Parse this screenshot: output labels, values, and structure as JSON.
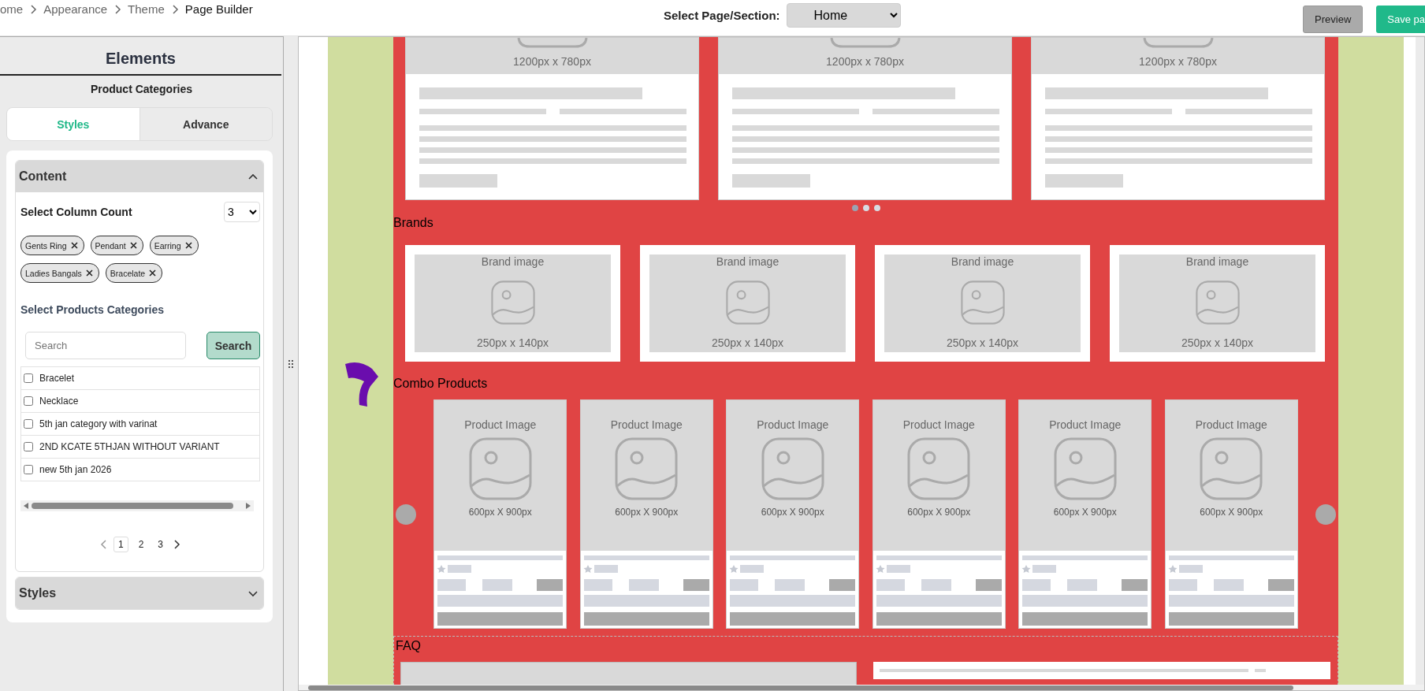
{
  "breadcrumb": [
    {
      "label": "ome",
      "current": false
    },
    {
      "label": "Appearance",
      "current": false
    },
    {
      "label": "Theme",
      "current": false
    },
    {
      "label": "Page Builder",
      "current": true
    }
  ],
  "page_select": {
    "label": "Select Page/Section:",
    "value": "Home"
  },
  "actions": [
    {
      "label": "Preview",
      "kind": "secondary"
    },
    {
      "label": "Save pa",
      "kind": "primary"
    }
  ],
  "panel": {
    "title": "Elements",
    "subtitle": "Product Categories",
    "tabs": [
      {
        "label": "Styles",
        "selected": true
      },
      {
        "label": "Advance",
        "selected": false
      }
    ],
    "content": {
      "title": "Content",
      "expanded": true,
      "column_count": {
        "label": "Select Column Count",
        "value": "3"
      },
      "tags": [
        {
          "label": "Gents Ring"
        },
        {
          "label": "Pendant"
        },
        {
          "label": "Earring"
        },
        {
          "label": "Ladies Bangals"
        },
        {
          "label": "Bracelate"
        }
      ],
      "categories": {
        "label": "Select Products Categories",
        "search_placeholder": "Search",
        "search_button": "Search",
        "items": [
          {
            "label": "Bracelet",
            "checked": false
          },
          {
            "label": "Necklace",
            "checked": false
          },
          {
            "label": "5th jan category with varinat",
            "checked": false
          },
          {
            "label": "2ND KCATE 5THJAN WITHOUT VARIANT",
            "checked": false
          },
          {
            "label": "new 5th jan 2026",
            "checked": false
          }
        ]
      },
      "pagination": [
        {
          "label": "1",
          "selected": true
        },
        {
          "label": "2",
          "selected": false
        },
        {
          "label": "3",
          "selected": false
        }
      ]
    },
    "styles": {
      "title": "Styles",
      "expanded": false
    }
  },
  "canvas": {
    "blog_cards": [
      {
        "image_size": "1200px x 780px"
      },
      {
        "image_size": "1200px x 780px"
      },
      {
        "image_size": "1200px x 780px"
      }
    ],
    "carousel_dots": [
      {
        "selected": true
      },
      {
        "selected": false
      },
      {
        "selected": false
      }
    ],
    "brands": {
      "title": "Brands",
      "cards": [
        {
          "label": "Brand image",
          "size": "250px x 140px"
        },
        {
          "label": "Brand image",
          "size": "250px x 140px"
        },
        {
          "label": "Brand image",
          "size": "250px x 140px"
        },
        {
          "label": "Brand image",
          "size": "250px x 140px"
        }
      ]
    },
    "combo": {
      "title": "Combo Products",
      "cards": [
        {
          "label": "Product Image",
          "size": "600px X 900px"
        },
        {
          "label": "Product Image",
          "size": "600px X 900px"
        },
        {
          "label": "Product Image",
          "size": "600px X 900px"
        },
        {
          "label": "Product Image",
          "size": "600px X 900px"
        },
        {
          "label": "Product Image",
          "size": "600px X 900px"
        },
        {
          "label": "Product Image",
          "size": "600px X 900px"
        }
      ]
    },
    "faq": {
      "title": "FAQ"
    }
  }
}
